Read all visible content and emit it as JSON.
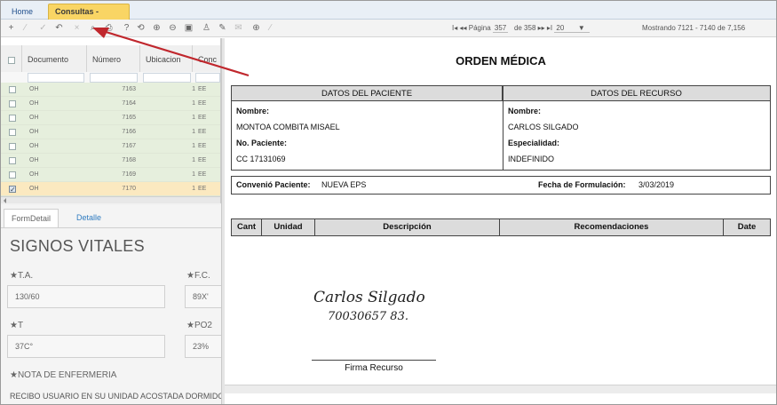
{
  "tabs": [
    {
      "label": "Home"
    },
    {
      "label": "Consultas -[gcon]",
      "close": "×"
    }
  ],
  "toolbar": {
    "icons": [
      "add-icon",
      "edit-icon",
      "check-icon",
      "undo-icon",
      "delete-icon",
      "search-icon",
      "print-icon",
      "help-icon",
      "refresh-icon",
      "zoom-in-icon",
      "zoom-out-icon",
      "copy-icon",
      "user-icon",
      "pin-icon",
      "mail-icon",
      "plus-circle-icon",
      "sign-icon"
    ],
    "glyphs": [
      "+",
      "⁄",
      "✓",
      "↶",
      "×",
      "⌕",
      "⎙",
      "?",
      "⟲",
      "⊕",
      "⊖",
      "▣",
      "♙",
      "✎",
      "✉",
      "⊕",
      "∕"
    ],
    "dim": [
      false,
      true,
      true,
      false,
      true,
      false,
      false,
      false,
      false,
      false,
      false,
      false,
      false,
      false,
      true,
      false,
      true
    ]
  },
  "pager": {
    "first": "I◂",
    "prev": "◂◂",
    "page_label": "Página",
    "page_value": "357",
    "of_label": "de 358",
    "next": "▸▸",
    "last": "▸I",
    "page_size": "20",
    "dropdown": "▼",
    "showing": "Mostrando 7121 - 7140 de 7,156"
  },
  "grid": {
    "headers": [
      "Documento",
      "Número",
      "Ubicacion",
      "Conc"
    ],
    "rows": [
      {
        "doc": "OH",
        "num": "7163",
        "ub": "1",
        "ee": "EE",
        "selected": false
      },
      {
        "doc": "OH",
        "num": "7164",
        "ub": "1",
        "ee": "EE",
        "selected": false
      },
      {
        "doc": "OH",
        "num": "7165",
        "ub": "1",
        "ee": "EE",
        "selected": false
      },
      {
        "doc": "OH",
        "num": "7166",
        "ub": "1",
        "ee": "EE",
        "selected": false
      },
      {
        "doc": "OH",
        "num": "7167",
        "ub": "1",
        "ee": "EE",
        "selected": false
      },
      {
        "doc": "OH",
        "num": "7168",
        "ub": "1",
        "ee": "EE",
        "selected": false
      },
      {
        "doc": "OH",
        "num": "7169",
        "ub": "1",
        "ee": "EE",
        "selected": false
      },
      {
        "doc": "OH",
        "num": "7170",
        "ub": "1",
        "ee": "EE",
        "selected": true
      }
    ]
  },
  "form": {
    "tabs": [
      "FormDetail",
      "Detalle"
    ],
    "section_title": "SIGNOS VITALES",
    "fields": [
      {
        "label": "★T.A.",
        "value": "130/60"
      },
      {
        "label": "★F.C.",
        "value": "89X'"
      },
      {
        "label": "★T",
        "value": "37C°"
      },
      {
        "label": "★PO2",
        "value": "23%"
      }
    ],
    "nota_label": "★NOTA DE ENFERMERIA",
    "nota_value": "RECIBO USUARIO  EN SU UNIDAD  ACOSTADA DORMIDO ALA VI"
  },
  "document": {
    "title": "ORDEN MÉDICA",
    "patient_header": "DATOS DEL PACIENTE",
    "resource_header": "DATOS DEL RECURSO",
    "nombre_label": "Nombre:",
    "patient_name": "MONTOA COMBITA MISAEL",
    "no_paciente_label": "No. Paciente:",
    "patient_id": "CC 17131069",
    "resource_nombre_label": "Nombre:",
    "resource_name": "CARLOS SILGADO",
    "especialidad_label": "Especialidad:",
    "especialidad_value": "INDEFINIDO",
    "convenio_label": "Convenió Paciente:",
    "convenio_value": "NUEVA EPS",
    "fecha_label": "Fecha de Formulación:",
    "fecha_value": "3/03/2019",
    "table_headers": [
      "Cant",
      "Unidad",
      "Descripción",
      "Recomendaciones",
      "Date"
    ],
    "signature_name": "Carlos Silgado",
    "signature_number": "70030657 83.",
    "signature_label": "Firma Recurso"
  },
  "colors": {
    "active_tab": "#f9d564",
    "grid_row": "#e6efdd",
    "selected_row": "#fbe9c0",
    "annotation_arrow": "#c0272d"
  }
}
